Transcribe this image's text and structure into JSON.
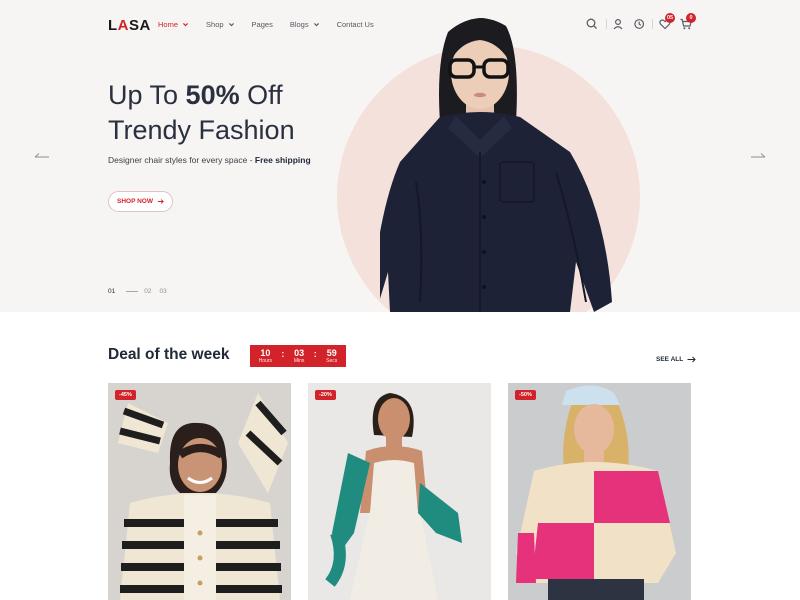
{
  "brand": {
    "logo_text_1": "L",
    "logo_text_2": "A",
    "logo_text_3": "SA"
  },
  "nav": {
    "items": [
      {
        "label": "Home",
        "active": true,
        "has_dropdown": true
      },
      {
        "label": "Shop",
        "active": false,
        "has_dropdown": true
      },
      {
        "label": "Pages",
        "active": false,
        "has_dropdown": false
      },
      {
        "label": "Blogs",
        "active": false,
        "has_dropdown": true
      },
      {
        "label": "Contact Us",
        "active": false,
        "has_dropdown": false
      }
    ]
  },
  "header_icons": {
    "search": "search-icon",
    "account": "user-icon",
    "recent": "history-icon",
    "wishlist": "heart-icon",
    "cart": "cart-icon",
    "wishlist_count": "05",
    "cart_count": "0"
  },
  "hero": {
    "title_line1_prefix": "Up To ",
    "title_line1_highlight": "50%",
    "title_line1_suffix": " Off",
    "title_line2": "Trendy Fashion",
    "subtitle_text": "Designer chair styles for every space - ",
    "subtitle_bold": "Free shipping",
    "cta_label": "SHOP NOW",
    "slides": [
      "01",
      "02",
      "03"
    ],
    "active_slide": 0
  },
  "deal": {
    "title": "Deal of the week",
    "countdown": {
      "hours": "10",
      "hours_label": "Hours",
      "mins": "03",
      "mins_label": "Mins",
      "secs": "59",
      "secs_label": "Secs"
    },
    "see_all_label": "SEE ALL",
    "products": [
      {
        "discount": "-45%"
      },
      {
        "discount": "-20%"
      },
      {
        "discount": "-50%"
      }
    ]
  },
  "colors": {
    "accent": "#d2232a",
    "hero_bg": "#f7f5f3",
    "hero_circle": "#f4e1dc",
    "text_dark": "#1f2937"
  }
}
